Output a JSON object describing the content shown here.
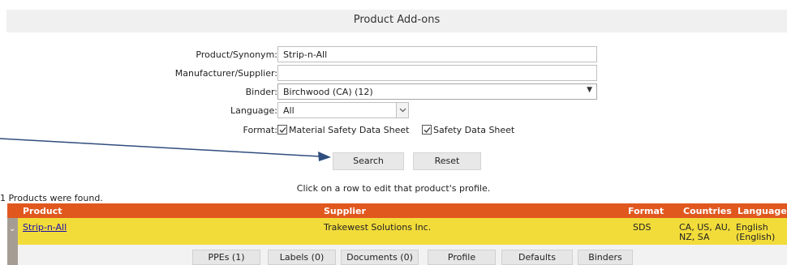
{
  "page": {
    "title": "Product Add-ons"
  },
  "form": {
    "product_label": "Product/Synonym:",
    "product_value": "Strip-n-All",
    "manufacturer_label": "Manufacturer/Supplier:",
    "manufacturer_value": "",
    "binder_label": "Binder:",
    "binder_value": "Birchwood (CA) (12)",
    "language_label": "Language:",
    "language_value": "All",
    "format_label": "Format:",
    "format_options": [
      {
        "label": "Material Safety Data Sheet",
        "checked": true
      },
      {
        "label": "Safety Data Sheet",
        "checked": true
      }
    ],
    "search_label": "Search",
    "reset_label": "Reset"
  },
  "results": {
    "hint": "Click on a row to edit that product's profile.",
    "count_text": "1 Products were found.",
    "columns": [
      "Product",
      "Supplier",
      "Format",
      "Countries",
      "Language"
    ],
    "rows": [
      {
        "product": "Strip-n-All",
        "supplier": "Trakewest Solutions Inc.",
        "format": "SDS",
        "countries_line1": "CA, US, AU,",
        "countries_line2": "NZ, SA",
        "language_line1": "English",
        "language_line2": "(English)"
      }
    ],
    "row_actions": [
      "PPEs (1)",
      "Labels (0)",
      "Documents (0)",
      "Profile",
      "Defaults",
      "Binders"
    ]
  },
  "colors": {
    "header_bg": "#e1581f",
    "row_bg": "#f2dc3a",
    "annotation_arrow": "#2f4d7e"
  },
  "icons": {
    "expand": "chevron-down-icon",
    "dropdown": "caret-down-icon",
    "checkbox": "checkmark-icon"
  }
}
